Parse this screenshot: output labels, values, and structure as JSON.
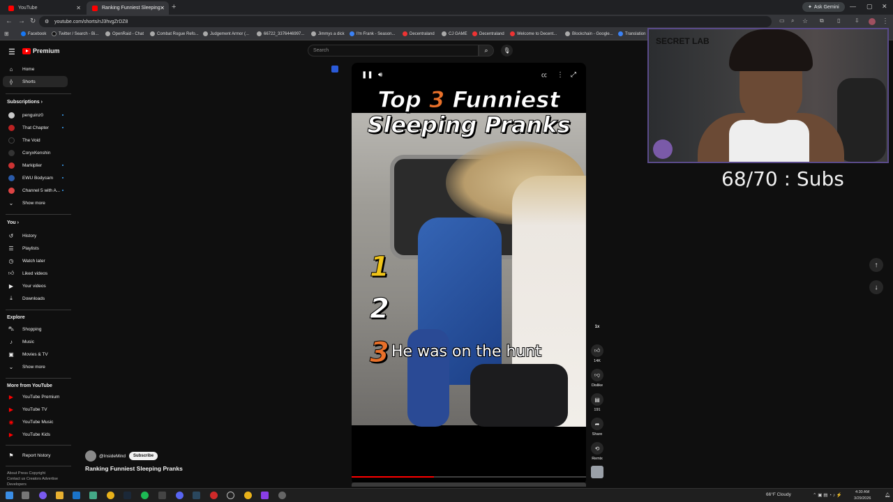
{
  "browser": {
    "tabs": [
      {
        "title": "YouTube",
        "color": "#ff0000"
      },
      {
        "title": "Ranking Funniest Sleeping",
        "color": "#ff0000"
      }
    ],
    "ask_gemini": "Ask Gemini",
    "url": "youtube.com/shorts/nJ3hvgZrDZ8",
    "bookmarks": [
      "Facebook",
      "Twitter / Search - Bi...",
      "OpenRaid - Chat",
      "Combat Rogue Refo...",
      "Judgement Armor (...",
      "66722_3376446997...",
      "Jimmys a dick",
      "I'm Frank - Season...",
      "Decentraland",
      "CJ GAME",
      "Decentraland",
      "Welcome to Decent...",
      "Blockchain - Google...",
      "Translation"
    ]
  },
  "youtube": {
    "logo": "Premium",
    "search_placeholder": "Search",
    "nav": [
      {
        "label": "Home",
        "icon": "home-icon"
      },
      {
        "label": "Shorts",
        "icon": "shorts-icon"
      }
    ],
    "subscriptions_heading": "Subscriptions",
    "subscriptions": [
      {
        "label": "penguinz0",
        "color": "#c9c9c9"
      },
      {
        "label": "That Chapter",
        "color": "#b22"
      },
      {
        "label": "The Void",
        "color": "#111"
      },
      {
        "label": "CoryxKenshin",
        "color": "#333"
      },
      {
        "label": "Markiplier",
        "color": "#c33"
      },
      {
        "label": "EWU Bodycam",
        "color": "#2a5aa8"
      },
      {
        "label": "Channel 5 with A...",
        "color": "#d44"
      }
    ],
    "show_more": "Show more",
    "you_heading": "You",
    "you_items": [
      {
        "label": "History",
        "icon": "history-icon"
      },
      {
        "label": "Playlists",
        "icon": "playlists-icon"
      },
      {
        "label": "Watch later",
        "icon": "watch-later-icon"
      },
      {
        "label": "Liked videos",
        "icon": "like-icon"
      },
      {
        "label": "Your videos",
        "icon": "your-videos-icon"
      },
      {
        "label": "Downloads",
        "icon": "download-icon"
      }
    ],
    "explore_heading": "Explore",
    "explore_items": [
      {
        "label": "Shopping",
        "icon": "shopping-icon"
      },
      {
        "label": "Music",
        "icon": "music-icon"
      },
      {
        "label": "Movies & TV",
        "icon": "movies-icon"
      }
    ],
    "show_more_2": "Show more",
    "more_heading": "More from YouTube",
    "more_items": [
      "YouTube Premium",
      "YouTube TV",
      "YouTube Music",
      "YouTube Kids"
    ],
    "report_history": "Report history",
    "footer_1": "About  Press  Copyright",
    "footer_2": "Contact us  Creators  Advertise",
    "footer_3": "Developers"
  },
  "short": {
    "title_line1_a": "Top ",
    "title_line1_b": "3",
    "title_line1_c": " Funniest",
    "title_line2": "Sleeping Pranks",
    "rank_1": "1",
    "rank_2": "2",
    "rank_3": "3",
    "caption": "He was on the hunt",
    "progress": 0.35,
    "channel": "@InsideMind",
    "subscribe": "Subscribe",
    "name": "Ranking Funniest Sleeping Pranks",
    "speed": "1x",
    "likes": "14K",
    "dislike": "Dislike",
    "comments": "191",
    "share": "Share",
    "remix": "Remix"
  },
  "overlay": {
    "subs_text": "68/70 : Subs",
    "webcam_logo": "SECRET LAB"
  },
  "taskbar": {
    "weather": "66°F  Cloudy",
    "time": "4:30 AM",
    "date": "3/29/2026"
  }
}
